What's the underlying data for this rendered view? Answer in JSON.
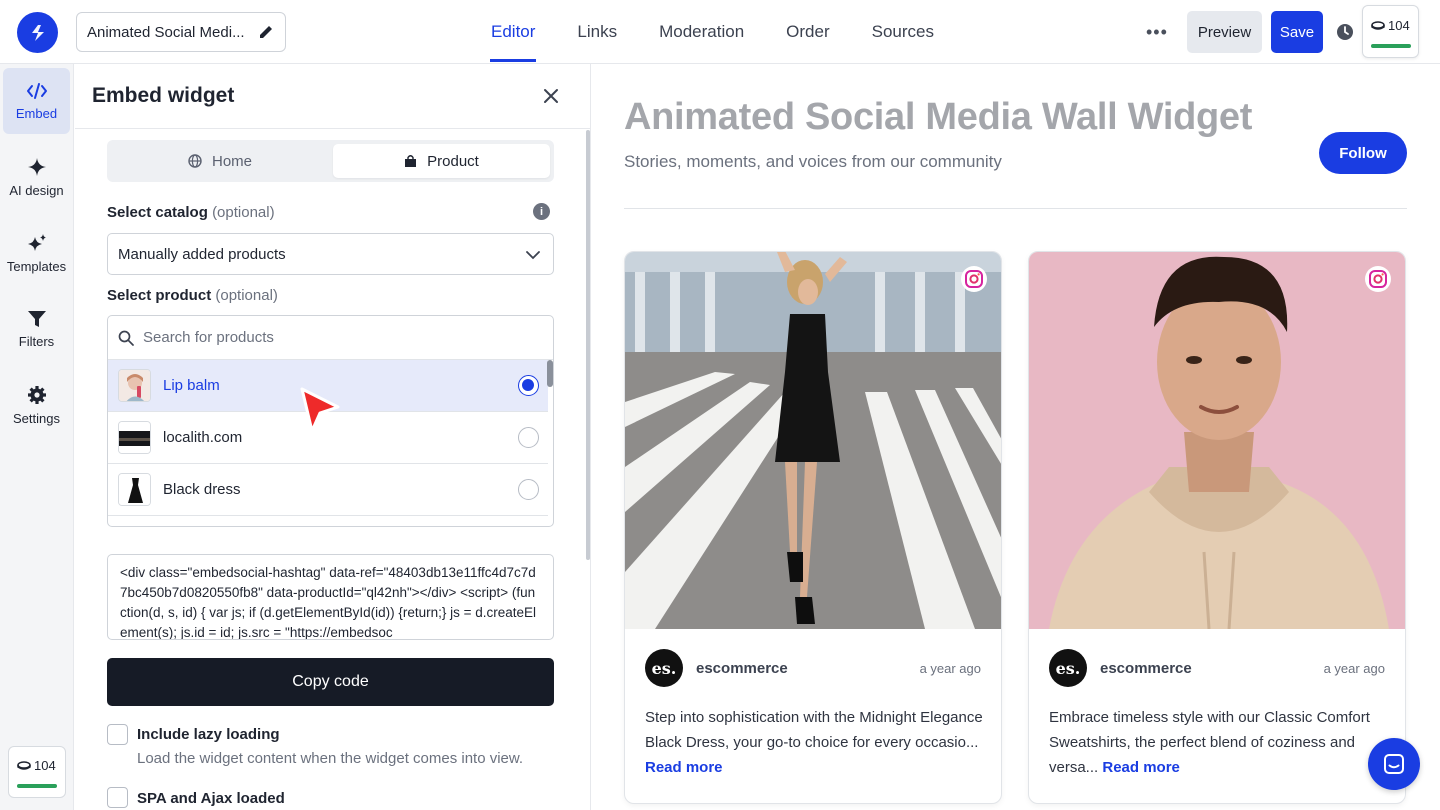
{
  "header": {
    "project_title": "Animated Social Medi...",
    "tabs": [
      "Editor",
      "Links",
      "Moderation",
      "Order",
      "Sources"
    ],
    "active_tab": "Editor",
    "preview_label": "Preview",
    "save_label": "Save",
    "credits": "104",
    "credits_level": 1.0,
    "colors": {
      "accent": "#1a3de2",
      "credits_bar": "#2aa05a"
    }
  },
  "rail": {
    "items": [
      {
        "label": "Embed",
        "icon": "code-icon",
        "active": true
      },
      {
        "label": "AI design",
        "icon": "sparkle-icon",
        "active": false
      },
      {
        "label": "Templates",
        "icon": "sparkles-icon",
        "active": false
      },
      {
        "label": "Filters",
        "icon": "filter-icon",
        "active": false
      },
      {
        "label": "Settings",
        "icon": "gear-icon",
        "active": false
      }
    ],
    "credits": "104"
  },
  "panel": {
    "title": "Embed widget",
    "segments": [
      {
        "label": "Home",
        "icon": "globe-icon",
        "selected": false
      },
      {
        "label": "Product",
        "icon": "bag-icon",
        "selected": true
      }
    ],
    "catalog": {
      "label": "Select catalog",
      "optional": "(optional)",
      "value": "Manually added products"
    },
    "product": {
      "label": "Select product",
      "optional": "(optional)",
      "search_placeholder": "Search for products",
      "items": [
        {
          "name": "Lip balm",
          "selected": true
        },
        {
          "name": "localith.com",
          "selected": false
        },
        {
          "name": "Black dress",
          "selected": false
        }
      ]
    },
    "embed_code": "<div class=\"embedsocial-hashtag\" data-ref=\"48403db13e11ffc4d7c7d7bc450b7d0820550fb8\" data-productId=\"ql42nh\"></div> <script> (function(d, s, id) { var js; if (d.getElementById(id)) {return;} js = d.createElement(s); js.id = id; js.src = \"https://embedsoc",
    "copy_label": "Copy code",
    "lazy": {
      "label": "Include lazy loading",
      "description": "Load the widget content when the widget comes into view."
    },
    "spa_label": "SPA and Ajax loaded"
  },
  "preview": {
    "title": "Animated Social Media Wall Widget",
    "subtitle": "Stories, moments, and voices from our community",
    "follow_label": "Follow",
    "cards": [
      {
        "avatar": "es.",
        "user": "escommerce",
        "time": "a year ago",
        "text": "Step into sophistication with the Midnight Elegance Black Dress, your go-to choice for every occasio...",
        "read_more": "Read more"
      },
      {
        "avatar": "es.",
        "user": "escommerce",
        "time": "a year ago",
        "text": "Embrace timeless style with our Classic Comfort Sweatshirts, the perfect blend of coziness and versa...",
        "read_more": "Read more"
      }
    ]
  }
}
